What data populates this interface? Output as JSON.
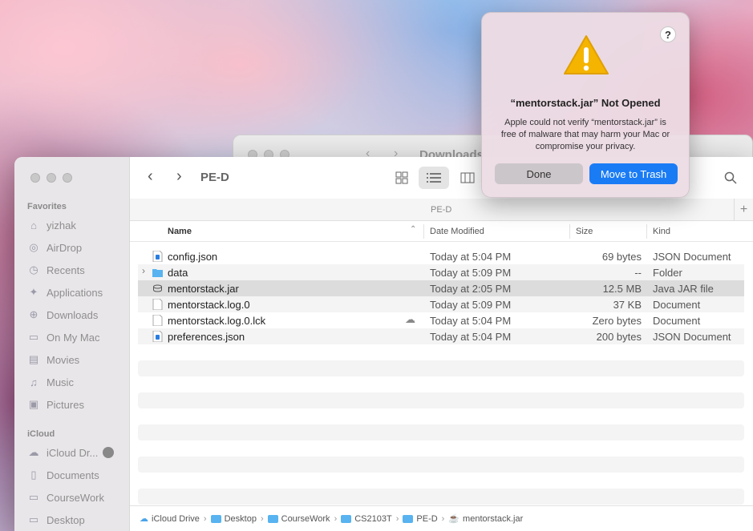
{
  "back_window": {
    "title": "Downloads"
  },
  "sidebar": {
    "favorites_header": "Favorites",
    "favorites": [
      {
        "label": "yizhak",
        "icon": "house-icon"
      },
      {
        "label": "AirDrop",
        "icon": "airdrop-icon"
      },
      {
        "label": "Recents",
        "icon": "clock-icon"
      },
      {
        "label": "Applications",
        "icon": "applications-icon"
      },
      {
        "label": "Downloads",
        "icon": "download-icon"
      },
      {
        "label": "On My Mac",
        "icon": "folder-icon"
      },
      {
        "label": "Movies",
        "icon": "film-icon"
      },
      {
        "label": "Music",
        "icon": "music-icon"
      },
      {
        "label": "Pictures",
        "icon": "photo-icon"
      }
    ],
    "icloud_header": "iCloud",
    "icloud": [
      {
        "label": "iCloud Dr...",
        "icon": "cloud-icon"
      },
      {
        "label": "Documents",
        "icon": "document-icon"
      },
      {
        "label": "CourseWork",
        "icon": "folder-icon"
      },
      {
        "label": "Desktop",
        "icon": "desktop-icon"
      }
    ]
  },
  "toolbar": {
    "title": "PE-D"
  },
  "path_label": "PE-D",
  "columns": {
    "name": "Name",
    "date": "Date Modified",
    "size": "Size",
    "kind": "Kind"
  },
  "files": [
    {
      "name": "config.json",
      "date": "Today at 5:04 PM",
      "size": "69 bytes",
      "kind": "JSON Document",
      "icon": "json-file-icon"
    },
    {
      "name": "data",
      "date": "Today at 5:09 PM",
      "size": "--",
      "kind": "Folder",
      "icon": "folder-icon"
    },
    {
      "name": "mentorstack.jar",
      "date": "Today at 2:05 PM",
      "size": "12.5 MB",
      "kind": "Java JAR file",
      "icon": "jar-file-icon"
    },
    {
      "name": "mentorstack.log.0",
      "date": "Today at 5:09 PM",
      "size": "37 KB",
      "kind": "Document",
      "icon": "document-icon"
    },
    {
      "name": "mentorstack.log.0.lck",
      "date": "Today at 5:04 PM",
      "size": "Zero bytes",
      "kind": "Document",
      "icon": "document-icon"
    },
    {
      "name": "preferences.json",
      "date": "Today at 5:04 PM",
      "size": "200 bytes",
      "kind": "JSON Document",
      "icon": "json-file-icon"
    }
  ],
  "bottom_path": [
    {
      "label": "iCloud Drive"
    },
    {
      "label": "Desktop"
    },
    {
      "label": "CourseWork"
    },
    {
      "label": "CS2103T"
    },
    {
      "label": "PE-D"
    },
    {
      "label": "mentorstack.jar"
    }
  ],
  "alert": {
    "title": "“mentorstack.jar” Not Opened",
    "message": "Apple could not verify “mentorstack.jar” is free of malware that may harm your Mac or compromise your privacy.",
    "done_label": "Done",
    "trash_label": "Move to Trash",
    "help_label": "?"
  },
  "colors": {
    "accent": "#1a7cf5",
    "folder": "#58b3f0",
    "warning": "#f5b400"
  }
}
